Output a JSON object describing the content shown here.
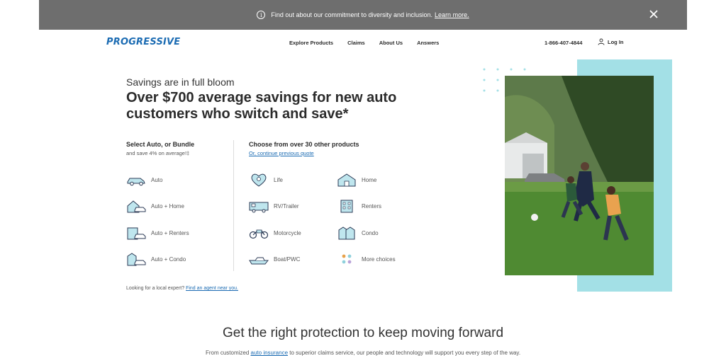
{
  "banner": {
    "text": "Find out about our commitment to diversity and inclusion.",
    "link": "Learn more."
  },
  "nav": {
    "logo": "PROGRESSIVE",
    "links": [
      "Explore Products",
      "Claims",
      "About Us",
      "Answers"
    ],
    "phone": "1-866-407-4844",
    "login": "Log In"
  },
  "hero": {
    "kicker": "Savings are in full bloom",
    "title": "Over $700 average savings for new auto customers who switch and save*"
  },
  "bundle": {
    "heading": "Select Auto, or Bundle",
    "subtext": "and save 4% on average!‡",
    "items": [
      "Auto",
      "Auto + Home",
      "Auto + Renters",
      "Auto + Condo"
    ]
  },
  "other": {
    "heading": "Choose from over 30 other products",
    "link": "Or, continue previous quote",
    "col1": [
      "Life",
      "RV/Trailer",
      "Motorcycle",
      "Boat/PWC"
    ],
    "col2": [
      "Home",
      "Renters",
      "Condo",
      "More choices"
    ]
  },
  "local": {
    "text": "Looking for a local expert?",
    "link": "Find an agent near you."
  },
  "section": {
    "title": "Get the right protection to keep moving forward",
    "sub_before": "From customized",
    "sub_link": "auto insurance",
    "sub_after": "to superior claims service, our people and technology will support you every step of the way."
  },
  "colors": {
    "brand": "#1c6cb3",
    "banner": "#6e6e6e",
    "accent": "#a3e0e6"
  }
}
